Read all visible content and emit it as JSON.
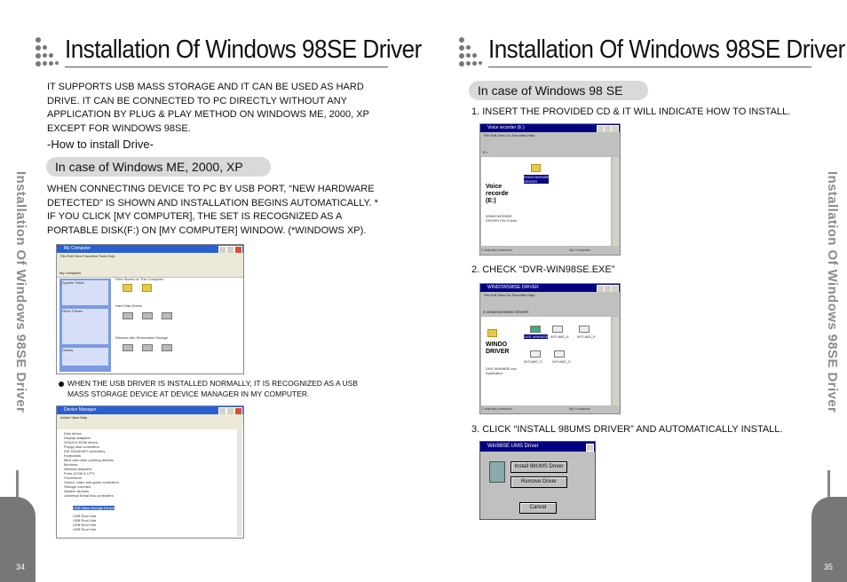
{
  "left": {
    "title": "Installation Of Windows 98SE Driver",
    "intro": "IT SUPPORTS USB MASS STORAGE AND IT CAN BE USED AS HARD DRIVE. IT CAN BE CONNECTED TO PC DIRECTLY WITHOUT ANY APPLICATION BY PLUG & PLAY METHOD ON WINDOWS ME, 2000, XP EXCEPT FOR WINDOWS 98SE.",
    "how_to": "-How to install Drive-",
    "pill": "In case of Windows ME, 2000, XP",
    "para": "WHEN CONNECTING DEVICE TO PC BY USB PORT, “NEW HARDWARE DETECTED” IS SHOWN AND INSTALLATION BEGINS AUTOMATICALLY. * IF YOU CLICK [MY COMPUTER], THE SET IS RECOGNIZED AS A PORTABLE DISK(F:) ON [MY COMPUTER] WINDOW. (*WINDOWS XP).",
    "bullet": "WHEN THE USB DRIVER IS INSTALLED NORMALLY, IT IS RECOGNIZED AS A USB MASS STORAGE DEVICE AT DEVICE MANAGER IN MY COMPUTER.",
    "side_text": "Installation Of Windows 98SE Driver",
    "page_number": "34",
    "shot1": {
      "title": "My Computer",
      "menu": "File  Edit  View  Favorites  Tools  Help",
      "addr": "My Computer",
      "group1": "Files Stored on This Computer",
      "group2": "Hard Disk Drives",
      "group3": "Devices with Removable Storage",
      "tasks": "System Tasks",
      "places": "Other Places",
      "details": "Details"
    },
    "shot2": {
      "title": "Device Manager",
      "menu": "Action  View  Help",
      "items": [
        "Disk drives",
        "Display adapters",
        "DVD/CD-ROM drives",
        "Floppy disk controllers",
        "IDE ATA/ATAPI controllers",
        "Keyboards",
        "Mice and other pointing devices",
        "Monitors",
        "Network adapters",
        "Ports (COM & LPT)",
        "Processors",
        "Sound, video and game controllers",
        "Storage volumes",
        "System devices",
        "Universal Serial Bus controllers",
        "USB Mass Storage Device",
        "USB Root Hub",
        "USB Root Hub",
        "USB Root Hub",
        "USB Root Hub"
      ]
    }
  },
  "right": {
    "title": "Installation Of Windows 98SE Driver",
    "pill": "In case of Windows 98 SE",
    "step1": "1. INSERT THE PROVIDED CD & IT WILL INDICATE HOW TO INSTALL.",
    "step2": "2. CHECK “DVR-WIN98SE.EXE”",
    "step3": "3. CLICK “INSTALL 98UMS DRIVER” AND AUTOMATICALLY INSTALL.",
    "side_text": "Installation Of Windows 98SE Driver",
    "page_number": "35",
    "shot1": {
      "title": "Voice recorder (E:)",
      "menu": "File  Edit  View  Go  Favorites  Help",
      "addr": "E:\\",
      "panel_title": "Voice recorde (E:)",
      "folder": "WINDOWS98SE DRIVER",
      "panel_sub": "WINDOWS98SE DRIVER File Folder",
      "status": "1 object(s) selected",
      "status2": "My Computer"
    },
    "shot2": {
      "title": "WINDOWS98SE DRIVER",
      "menu": "File  Edit  View  Go  Favorites  Help",
      "addr": "E:\\WINDOWS98SE DRIVER",
      "panel_title": "WINDO DRIVER",
      "panel_sub": "DVR-WIN98SE.exe Application",
      "files": [
        "DVR-WIN98SE",
        "99TUMS_A",
        "99TUMS_P",
        "99TUMS_P...",
        "99TUMS_S"
      ],
      "status": "1 object(s) selected",
      "status2": "My Computer"
    },
    "shot3": {
      "title": "Win98SE UMS Driver",
      "btn_install": "Install 98UMS Driver",
      "btn_remove": "Remove Driver",
      "btn_cancel": "Cancel"
    }
  }
}
